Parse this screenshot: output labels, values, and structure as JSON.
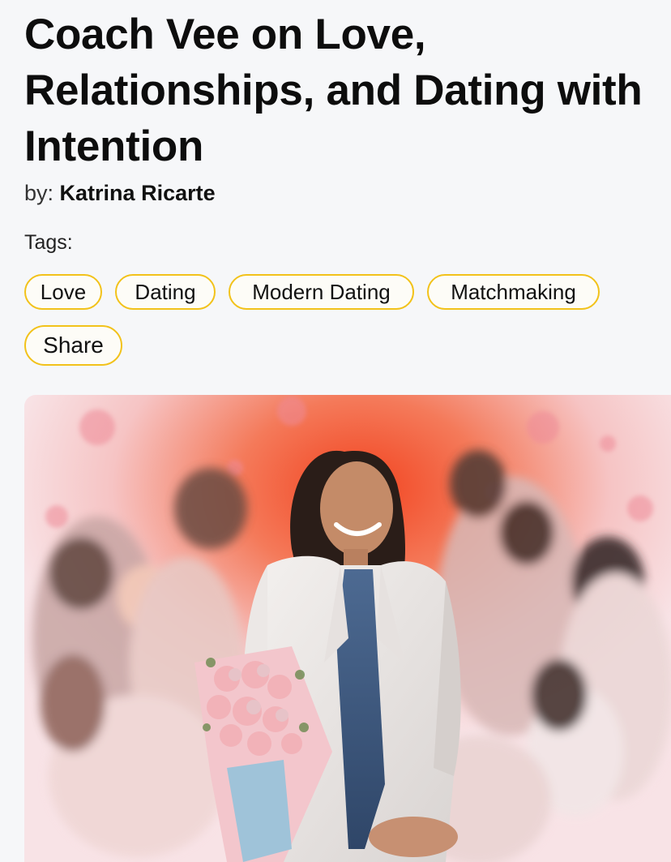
{
  "article": {
    "title": "Coach Vee on Love, Relationships, and Dating with Intention",
    "by_label": "by:",
    "author": "Katrina Ricarte"
  },
  "tags": {
    "label": "Tags:",
    "items": [
      "Love",
      "Dating",
      "Modern Dating",
      "Matchmaking"
    ]
  },
  "share_label": "Share",
  "colors": {
    "tag_border": "#f2c21a",
    "background": "#f6f7f9"
  }
}
